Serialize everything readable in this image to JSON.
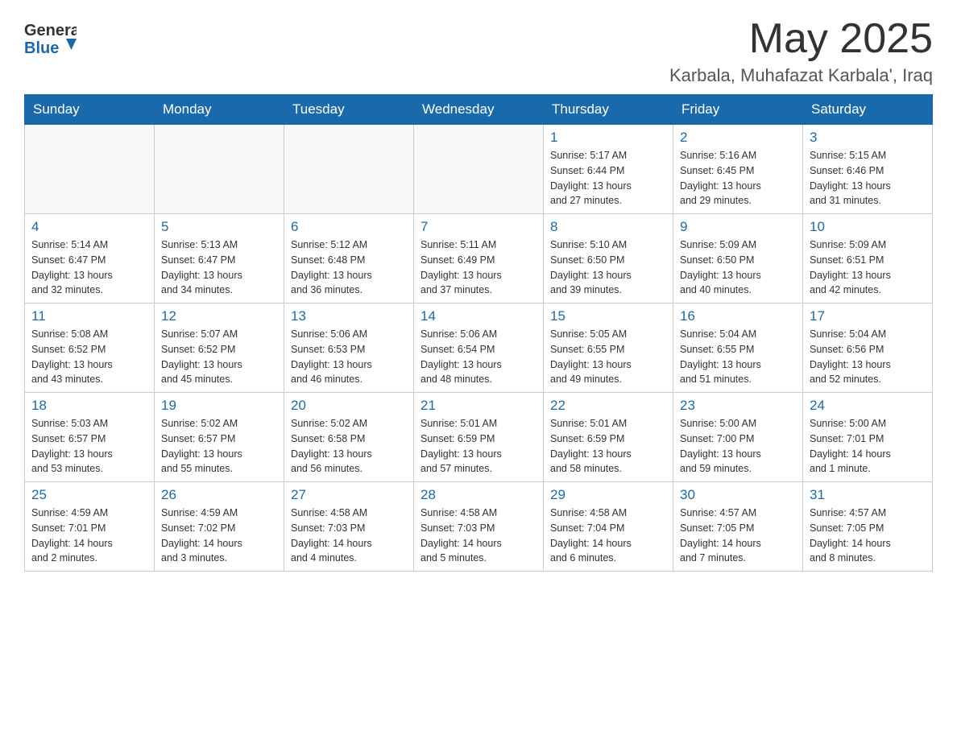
{
  "header": {
    "logo_general": "General",
    "logo_blue": "Blue",
    "month_year": "May 2025",
    "location": "Karbala, Muhafazat Karbala', Iraq"
  },
  "weekdays": [
    "Sunday",
    "Monday",
    "Tuesday",
    "Wednesday",
    "Thursday",
    "Friday",
    "Saturday"
  ],
  "weeks": [
    [
      {
        "day": "",
        "info": ""
      },
      {
        "day": "",
        "info": ""
      },
      {
        "day": "",
        "info": ""
      },
      {
        "day": "",
        "info": ""
      },
      {
        "day": "1",
        "info": "Sunrise: 5:17 AM\nSunset: 6:44 PM\nDaylight: 13 hours\nand 27 minutes."
      },
      {
        "day": "2",
        "info": "Sunrise: 5:16 AM\nSunset: 6:45 PM\nDaylight: 13 hours\nand 29 minutes."
      },
      {
        "day": "3",
        "info": "Sunrise: 5:15 AM\nSunset: 6:46 PM\nDaylight: 13 hours\nand 31 minutes."
      }
    ],
    [
      {
        "day": "4",
        "info": "Sunrise: 5:14 AM\nSunset: 6:47 PM\nDaylight: 13 hours\nand 32 minutes."
      },
      {
        "day": "5",
        "info": "Sunrise: 5:13 AM\nSunset: 6:47 PM\nDaylight: 13 hours\nand 34 minutes."
      },
      {
        "day": "6",
        "info": "Sunrise: 5:12 AM\nSunset: 6:48 PM\nDaylight: 13 hours\nand 36 minutes."
      },
      {
        "day": "7",
        "info": "Sunrise: 5:11 AM\nSunset: 6:49 PM\nDaylight: 13 hours\nand 37 minutes."
      },
      {
        "day": "8",
        "info": "Sunrise: 5:10 AM\nSunset: 6:50 PM\nDaylight: 13 hours\nand 39 minutes."
      },
      {
        "day": "9",
        "info": "Sunrise: 5:09 AM\nSunset: 6:50 PM\nDaylight: 13 hours\nand 40 minutes."
      },
      {
        "day": "10",
        "info": "Sunrise: 5:09 AM\nSunset: 6:51 PM\nDaylight: 13 hours\nand 42 minutes."
      }
    ],
    [
      {
        "day": "11",
        "info": "Sunrise: 5:08 AM\nSunset: 6:52 PM\nDaylight: 13 hours\nand 43 minutes."
      },
      {
        "day": "12",
        "info": "Sunrise: 5:07 AM\nSunset: 6:52 PM\nDaylight: 13 hours\nand 45 minutes."
      },
      {
        "day": "13",
        "info": "Sunrise: 5:06 AM\nSunset: 6:53 PM\nDaylight: 13 hours\nand 46 minutes."
      },
      {
        "day": "14",
        "info": "Sunrise: 5:06 AM\nSunset: 6:54 PM\nDaylight: 13 hours\nand 48 minutes."
      },
      {
        "day": "15",
        "info": "Sunrise: 5:05 AM\nSunset: 6:55 PM\nDaylight: 13 hours\nand 49 minutes."
      },
      {
        "day": "16",
        "info": "Sunrise: 5:04 AM\nSunset: 6:55 PM\nDaylight: 13 hours\nand 51 minutes."
      },
      {
        "day": "17",
        "info": "Sunrise: 5:04 AM\nSunset: 6:56 PM\nDaylight: 13 hours\nand 52 minutes."
      }
    ],
    [
      {
        "day": "18",
        "info": "Sunrise: 5:03 AM\nSunset: 6:57 PM\nDaylight: 13 hours\nand 53 minutes."
      },
      {
        "day": "19",
        "info": "Sunrise: 5:02 AM\nSunset: 6:57 PM\nDaylight: 13 hours\nand 55 minutes."
      },
      {
        "day": "20",
        "info": "Sunrise: 5:02 AM\nSunset: 6:58 PM\nDaylight: 13 hours\nand 56 minutes."
      },
      {
        "day": "21",
        "info": "Sunrise: 5:01 AM\nSunset: 6:59 PM\nDaylight: 13 hours\nand 57 minutes."
      },
      {
        "day": "22",
        "info": "Sunrise: 5:01 AM\nSunset: 6:59 PM\nDaylight: 13 hours\nand 58 minutes."
      },
      {
        "day": "23",
        "info": "Sunrise: 5:00 AM\nSunset: 7:00 PM\nDaylight: 13 hours\nand 59 minutes."
      },
      {
        "day": "24",
        "info": "Sunrise: 5:00 AM\nSunset: 7:01 PM\nDaylight: 14 hours\nand 1 minute."
      }
    ],
    [
      {
        "day": "25",
        "info": "Sunrise: 4:59 AM\nSunset: 7:01 PM\nDaylight: 14 hours\nand 2 minutes."
      },
      {
        "day": "26",
        "info": "Sunrise: 4:59 AM\nSunset: 7:02 PM\nDaylight: 14 hours\nand 3 minutes."
      },
      {
        "day": "27",
        "info": "Sunrise: 4:58 AM\nSunset: 7:03 PM\nDaylight: 14 hours\nand 4 minutes."
      },
      {
        "day": "28",
        "info": "Sunrise: 4:58 AM\nSunset: 7:03 PM\nDaylight: 14 hours\nand 5 minutes."
      },
      {
        "day": "29",
        "info": "Sunrise: 4:58 AM\nSunset: 7:04 PM\nDaylight: 14 hours\nand 6 minutes."
      },
      {
        "day": "30",
        "info": "Sunrise: 4:57 AM\nSunset: 7:05 PM\nDaylight: 14 hours\nand 7 minutes."
      },
      {
        "day": "31",
        "info": "Sunrise: 4:57 AM\nSunset: 7:05 PM\nDaylight: 14 hours\nand 8 minutes."
      }
    ]
  ]
}
